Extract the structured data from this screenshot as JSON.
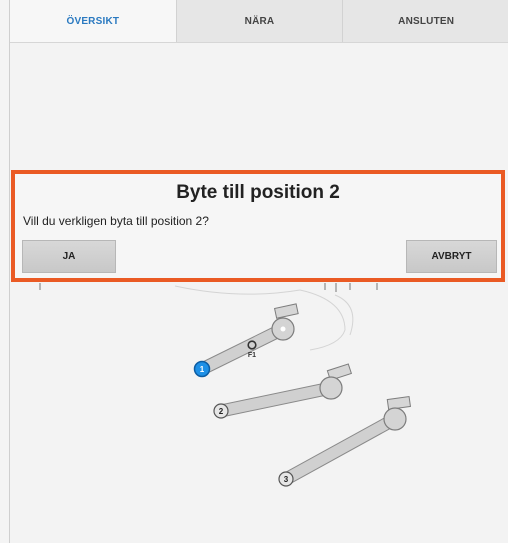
{
  "tabs": [
    {
      "label": "ÖVERSIKT",
      "active": true
    },
    {
      "label": "NÄRA",
      "active": false
    },
    {
      "label": "ANSLUTEN",
      "active": false
    }
  ],
  "scene": {
    "arms": [
      {
        "label": "1",
        "highlighted": true
      },
      {
        "label": "2",
        "highlighted": false
      },
      {
        "label": "3",
        "highlighted": false
      }
    ],
    "marker_label": "F1"
  },
  "dialog": {
    "title": "Byte till position 2",
    "message": "Vill du verkligen byta till position 2?",
    "confirm_label": "JA",
    "cancel_label": "AVBRYT"
  },
  "colors": {
    "accent": "#2a79c0",
    "dialog_border": "#ea5a24",
    "highlight": "#1e90e6",
    "arm_fill": "#cfcfcf"
  }
}
